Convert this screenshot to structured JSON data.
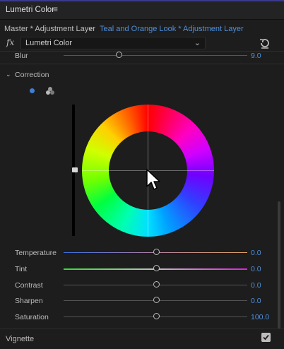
{
  "panel": {
    "title": "Lumetri Color",
    "menu_icon": "hamburger-icon"
  },
  "source": {
    "master": "Master * Adjustment Layer",
    "clip": "Teal and Orange Look * Adjustment Layer"
  },
  "effect": {
    "fx_label": "fx",
    "selected": "Lumetri Color"
  },
  "blur": {
    "label": "Blur",
    "value": "9.0",
    "level": 0.3
  },
  "correction": {
    "label": "Correction"
  },
  "sliders": [
    {
      "label": "Temperature",
      "value": "0.0",
      "level": 0.5
    },
    {
      "label": "Tint",
      "value": "0.0",
      "level": 0.5
    },
    {
      "label": "Contrast",
      "value": "0.0",
      "level": 0.5
    },
    {
      "label": "Sharpen",
      "value": "0.0",
      "level": 0.5
    },
    {
      "label": "Saturation",
      "value": "100.0",
      "level": 0.5
    }
  ],
  "vignette": {
    "label": "Vignette",
    "checked": true
  },
  "colors": {
    "accent": "#4f8fdc",
    "background": "#1d1d1d"
  }
}
